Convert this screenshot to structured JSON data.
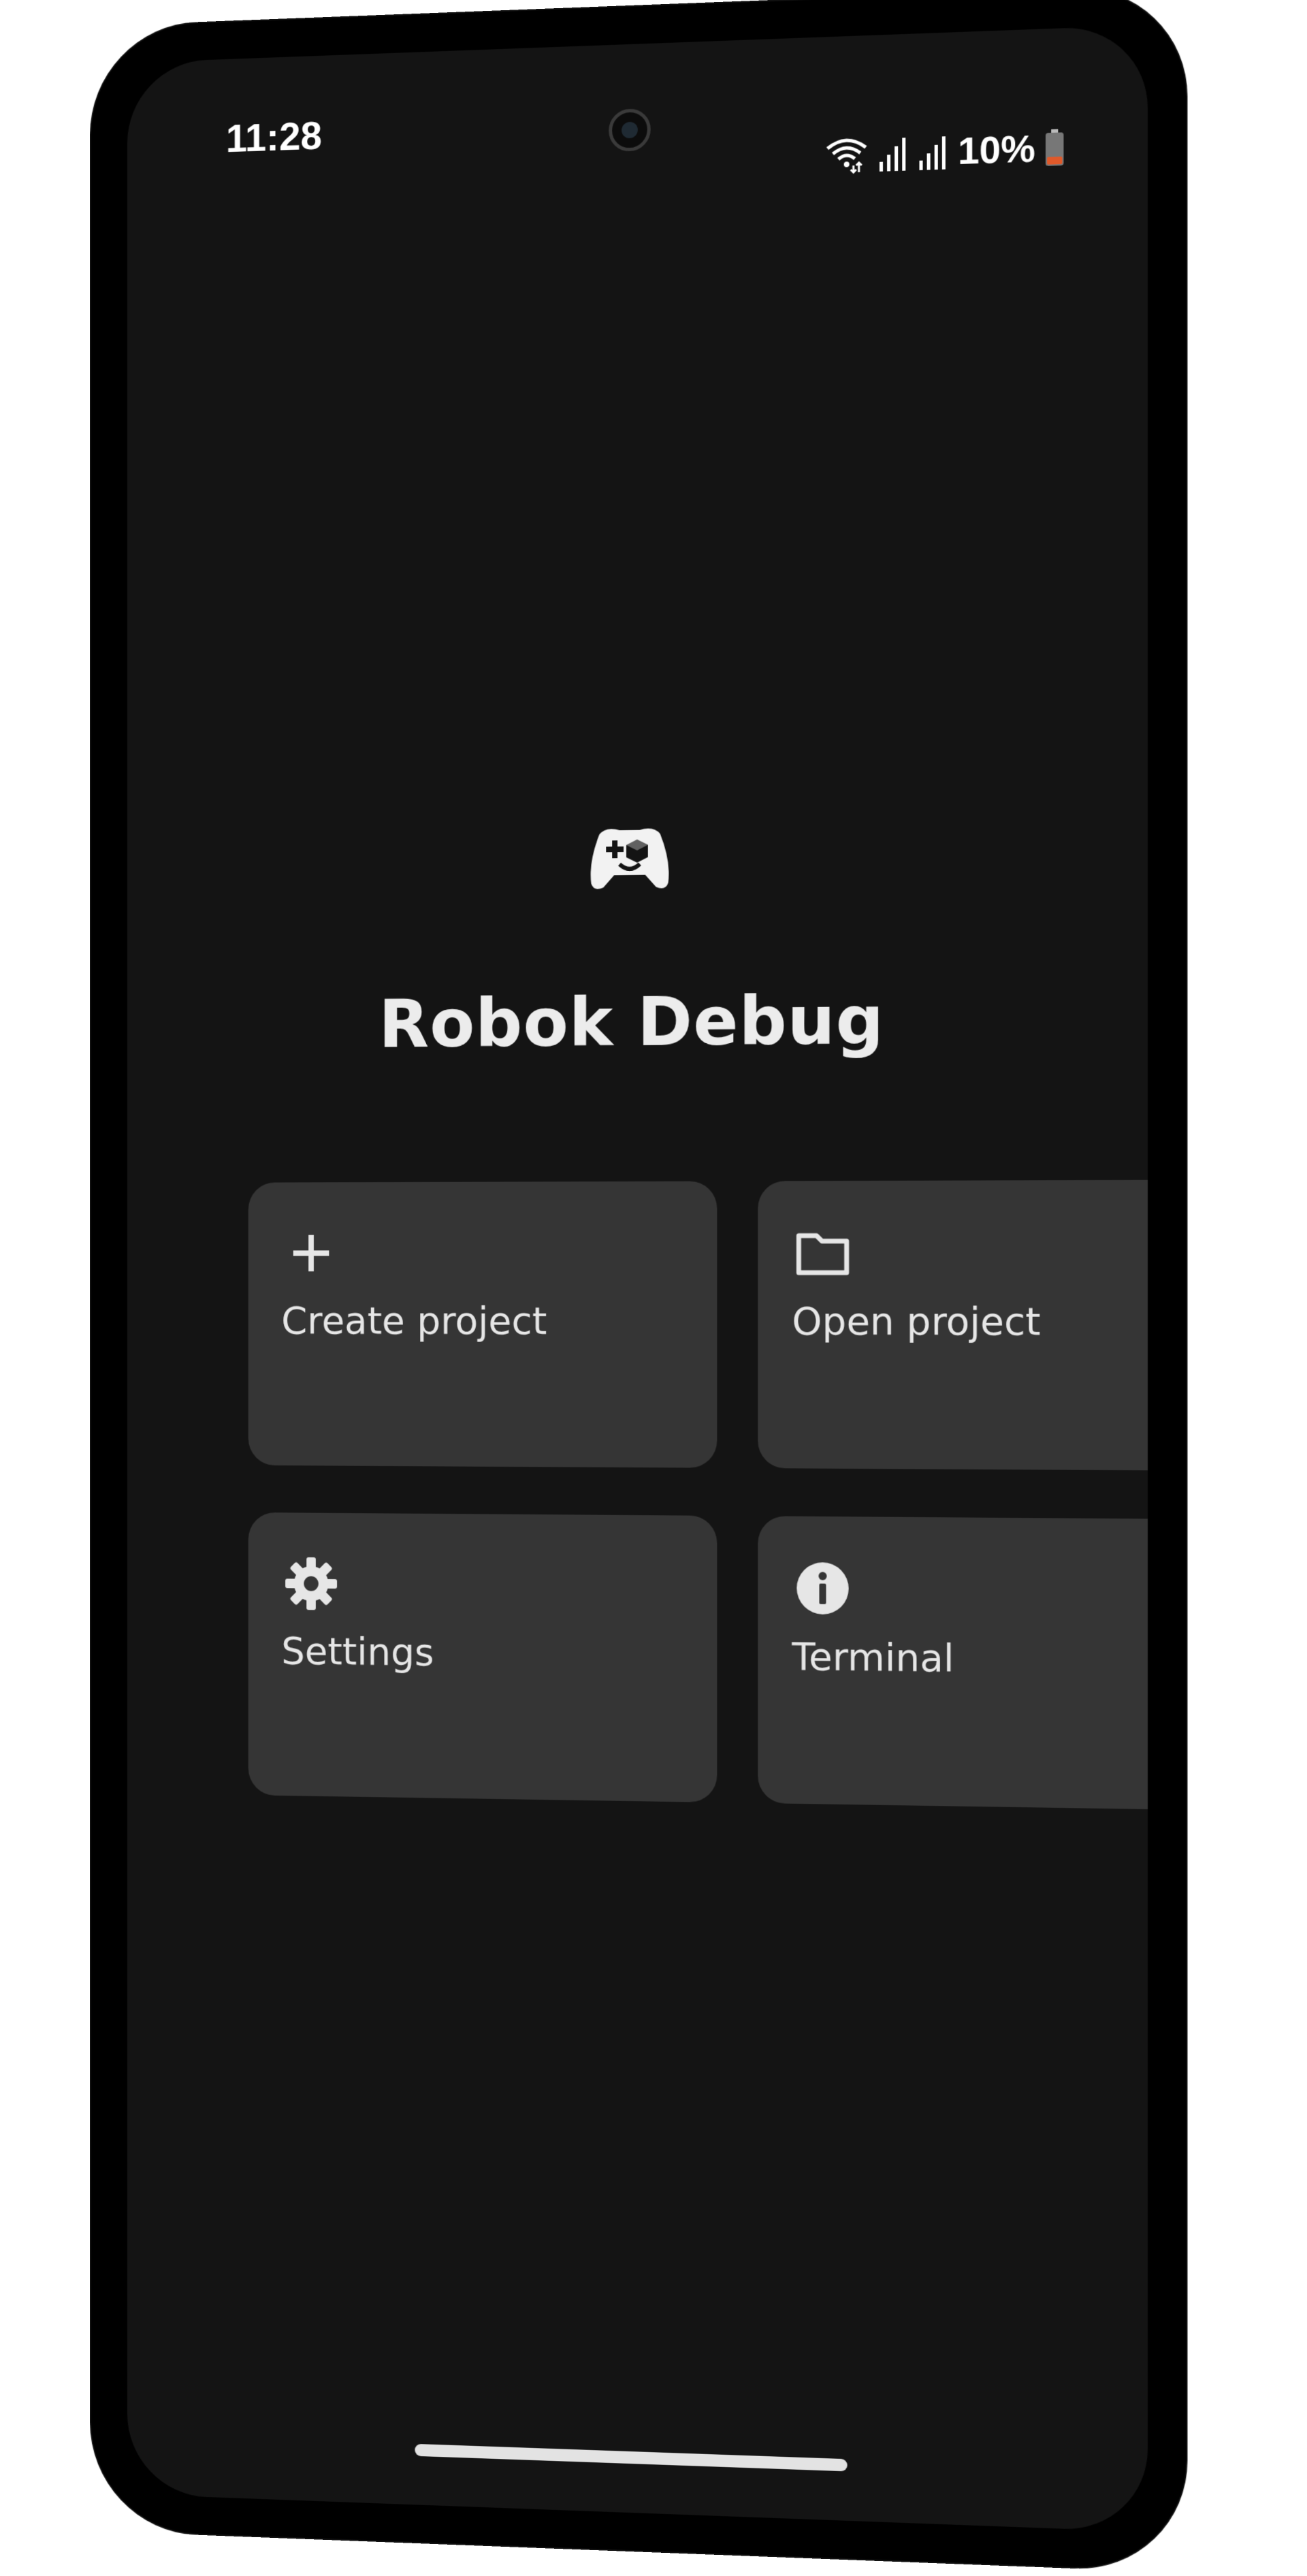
{
  "status_bar": {
    "time": "11:28",
    "battery": "10%",
    "icons": [
      "wifi-icon",
      "signal-icon",
      "signal-icon",
      "battery-icon"
    ]
  },
  "app": {
    "title": "Robok Debug",
    "logo_icon": "gamepad-icon"
  },
  "actions": {
    "create": {
      "label": "Create project",
      "icon": "plus-icon"
    },
    "open": {
      "label": "Open project",
      "icon": "folder-icon"
    },
    "settings": {
      "label": "Settings",
      "icon": "gear-icon"
    },
    "terminal": {
      "label": "Terminal",
      "icon": "info-icon"
    }
  },
  "colors": {
    "screen_bg": "#141414",
    "card_bg": "#353535",
    "text": "#e6e6e6",
    "battery_low": "#e0592a"
  }
}
